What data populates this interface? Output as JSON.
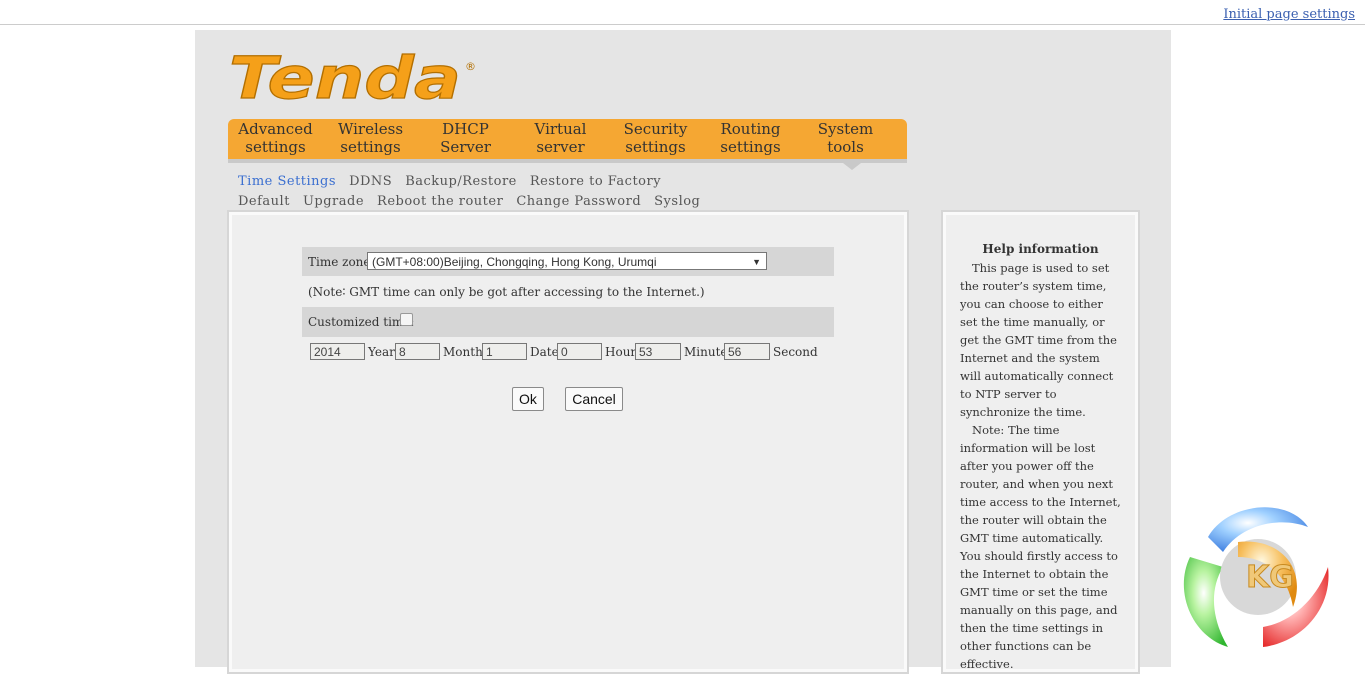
{
  "header": {
    "initial_link": "Initial page settings"
  },
  "logo": {
    "text": "Tenda",
    "registered": "®",
    "color": "#f5a019"
  },
  "nav": {
    "items": [
      {
        "label": "Advanced\nsettings"
      },
      {
        "label": "Wireless\nsettings"
      },
      {
        "label": "DHCP\nServer"
      },
      {
        "label": "Virtual\nserver"
      },
      {
        "label": "Security\nsettings"
      },
      {
        "label": "Routing\nsettings"
      },
      {
        "label": "System\ntools"
      }
    ],
    "active": "System tools"
  },
  "subnav": {
    "items": [
      "Time Settings",
      "DDNS",
      "Backup/Restore",
      "Restore to Factory Default",
      "Upgrade",
      "Reboot the router",
      "Change Password",
      "Syslog"
    ],
    "active": "Time Settings"
  },
  "form": {
    "timezone_label": "Time zone:",
    "timezone_value": "(GMT+08:00)Beijing, Chongqing, Hong Kong, Urumqi",
    "note": "(Note∶ GMT time can only be got after accessing to the Internet.)",
    "customized_label": "Customized time:",
    "customized_checked": false,
    "year": "2014",
    "year_label": "Year",
    "month": "8",
    "month_label": "Month",
    "date": "1",
    "date_label": "Date",
    "hour": "0",
    "hour_label": "Hour",
    "minute": "53",
    "minute_label": "Minute",
    "second": "56",
    "second_label": "Second",
    "ok_label": "Ok",
    "cancel_label": "Cancel"
  },
  "help": {
    "title": "Help information",
    "p1": "This page is used to set the router’s system time, you can choose to either set the time manually, or get the GMT time from the Internet and the system will automatically connect to NTP server to synchronize the time.",
    "p2": "Note: The time information will be lost after you power off the router, and when you next time access to the Internet, the router will obtain the GMT time automatically. You should firstly access to the Internet to obtain the GMT time or set the time manually on this page, and then the time settings in other functions can be effective."
  },
  "watermark": {
    "text": "KG"
  }
}
